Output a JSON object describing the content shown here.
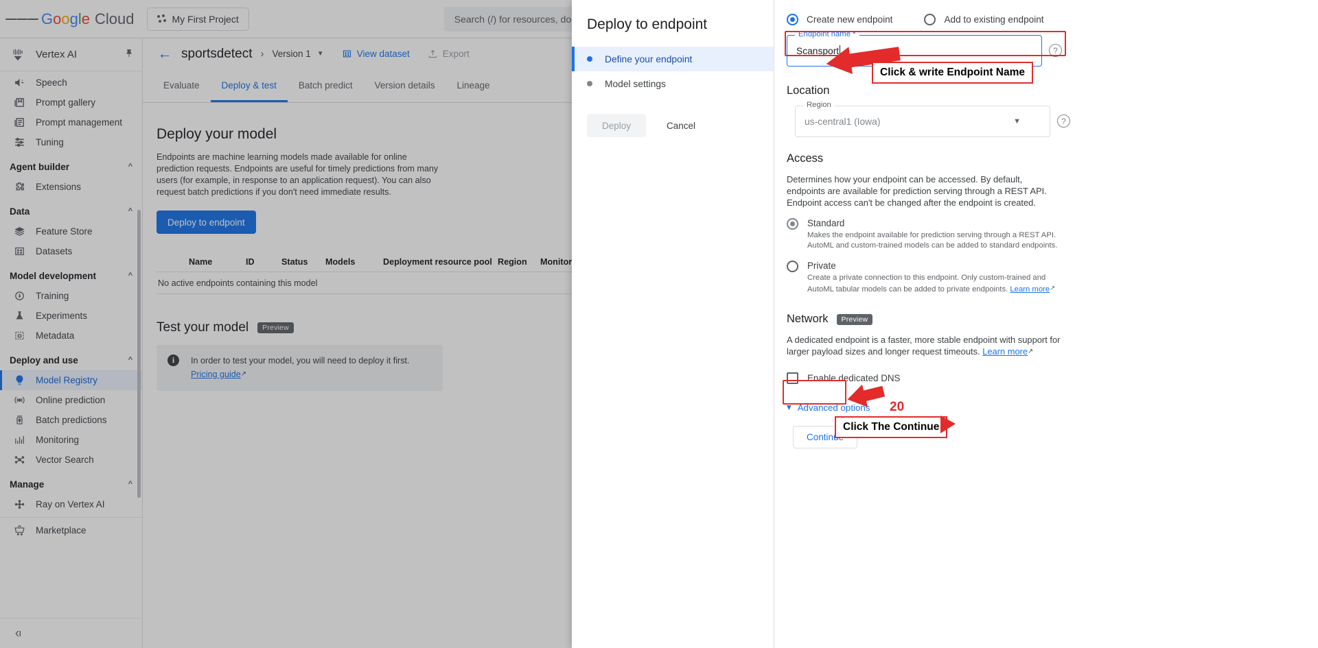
{
  "topbar": {
    "logo": {
      "google": "Google",
      "cloud": "Cloud"
    },
    "project_chip": "My First Project",
    "search_placeholder": "Search (/) for resources, docs, products, and more"
  },
  "sidebar": {
    "product": "Vertex AI",
    "collapse_label": "",
    "items": [
      {
        "label": "Speech",
        "icon": "speech-icon",
        "type": "item"
      },
      {
        "label": "Prompt gallery",
        "icon": "gallery-icon",
        "type": "item"
      },
      {
        "label": "Prompt management",
        "icon": "management-icon",
        "type": "item"
      },
      {
        "label": "Tuning",
        "icon": "tuning-icon",
        "type": "item"
      },
      {
        "label": "Agent builder",
        "type": "group"
      },
      {
        "label": "Extensions",
        "icon": "extension-icon",
        "type": "item"
      },
      {
        "label": "Data",
        "type": "group"
      },
      {
        "label": "Feature Store",
        "icon": "layers-icon",
        "type": "item"
      },
      {
        "label": "Datasets",
        "icon": "grid-icon",
        "type": "item"
      },
      {
        "label": "Model development",
        "type": "group"
      },
      {
        "label": "Training",
        "icon": "training-icon",
        "type": "item"
      },
      {
        "label": "Experiments",
        "icon": "flask-icon",
        "type": "item"
      },
      {
        "label": "Metadata",
        "icon": "metadata-icon",
        "type": "item"
      },
      {
        "label": "Deploy and use",
        "type": "group"
      },
      {
        "label": "Model Registry",
        "icon": "registry-icon",
        "type": "item",
        "active": true
      },
      {
        "label": "Online prediction",
        "icon": "broadcast-icon",
        "type": "item"
      },
      {
        "label": "Batch predictions",
        "icon": "batch-icon",
        "type": "item"
      },
      {
        "label": "Monitoring",
        "icon": "monitoring-icon",
        "type": "item"
      },
      {
        "label": "Vector Search",
        "icon": "vector-icon",
        "type": "item"
      },
      {
        "label": "Manage",
        "type": "group"
      },
      {
        "label": "Ray on Vertex AI",
        "icon": "ray-icon",
        "type": "item"
      },
      {
        "label": "Marketplace",
        "icon": "cart-icon",
        "type": "item",
        "separator": true
      }
    ]
  },
  "breadcrumb": {
    "model_name": "sportsdetect",
    "version": "Version 1",
    "view_dataset": "View dataset",
    "export": "Export"
  },
  "tabs": [
    {
      "label": "Evaluate",
      "active": false
    },
    {
      "label": "Deploy & test",
      "active": true
    },
    {
      "label": "Batch predict",
      "active": false
    },
    {
      "label": "Version details",
      "active": false
    },
    {
      "label": "Lineage",
      "active": false
    }
  ],
  "main": {
    "deploy_heading": "Deploy your model",
    "deploy_description": "Endpoints are machine learning models made available for online prediction requests. Endpoints are useful for timely predictions from many users (for example, in response to an application request). You can also request batch predictions if you don't need immediate results.",
    "deploy_button": "Deploy to endpoint",
    "table_headers": [
      "Name",
      "ID",
      "Status",
      "Models",
      "Deployment resource pool",
      "Region",
      "Monitoring"
    ],
    "table_empty": "No active endpoints containing this model",
    "test_heading": "Test your model",
    "test_badge": "Preview",
    "test_info_prefix": "In order to test your model, you will need to deploy it first. ",
    "test_info_link": "Pricing guide"
  },
  "modal": {
    "title": "Deploy to endpoint",
    "steps": [
      {
        "label": "Define your endpoint",
        "active": true
      },
      {
        "label": "Model settings",
        "active": false
      }
    ],
    "deploy_button": "Deploy",
    "cancel_button": "Cancel",
    "endpoint_mode": {
      "create_new": "Create new endpoint",
      "add_existing": "Add to existing endpoint",
      "selected": "create_new"
    },
    "endpoint_name": {
      "label": "Endpoint name *",
      "value": "Scansport"
    },
    "location": {
      "heading": "Location",
      "region_label": "Region",
      "region_value": "us-central1 (Iowa)"
    },
    "access": {
      "heading": "Access",
      "description": "Determines how your endpoint can be accessed. By default, endpoints are available for prediction serving through a REST API. Endpoint access can't be changed after the endpoint is created.",
      "options": [
        {
          "title": "Standard",
          "description": "Makes the endpoint available for prediction serving through a REST API. AutoML and custom-trained models can be added to standard endpoints.",
          "selected": true,
          "link": ""
        },
        {
          "title": "Private",
          "description": "Create a private connection to this endpoint. Only custom-trained and AutoML tabular models can be added to private endpoints. ",
          "selected": false,
          "link": "Learn more"
        }
      ]
    },
    "network": {
      "heading": "Network",
      "badge": "Preview",
      "description": "A dedicated endpoint is a faster, more stable endpoint with support for larger payload sizes and longer request timeouts. ",
      "link": "Learn more",
      "checkbox_label": "Enable dedicated DNS",
      "checkbox_checked": false
    },
    "advanced_options": "Advanced options",
    "continue_button": "Continue"
  },
  "annotations": [
    {
      "name": "endpoint-name-callout",
      "text": "Click & write Endpoint Name"
    },
    {
      "name": "continue-callout",
      "text": "Click The Continue"
    },
    {
      "name": "step-number",
      "text": "20"
    }
  ],
  "colors": {
    "accent": "#1a73e8",
    "annotation": "#e32b2b",
    "text_primary": "#202124",
    "text_secondary": "#5f6368"
  }
}
